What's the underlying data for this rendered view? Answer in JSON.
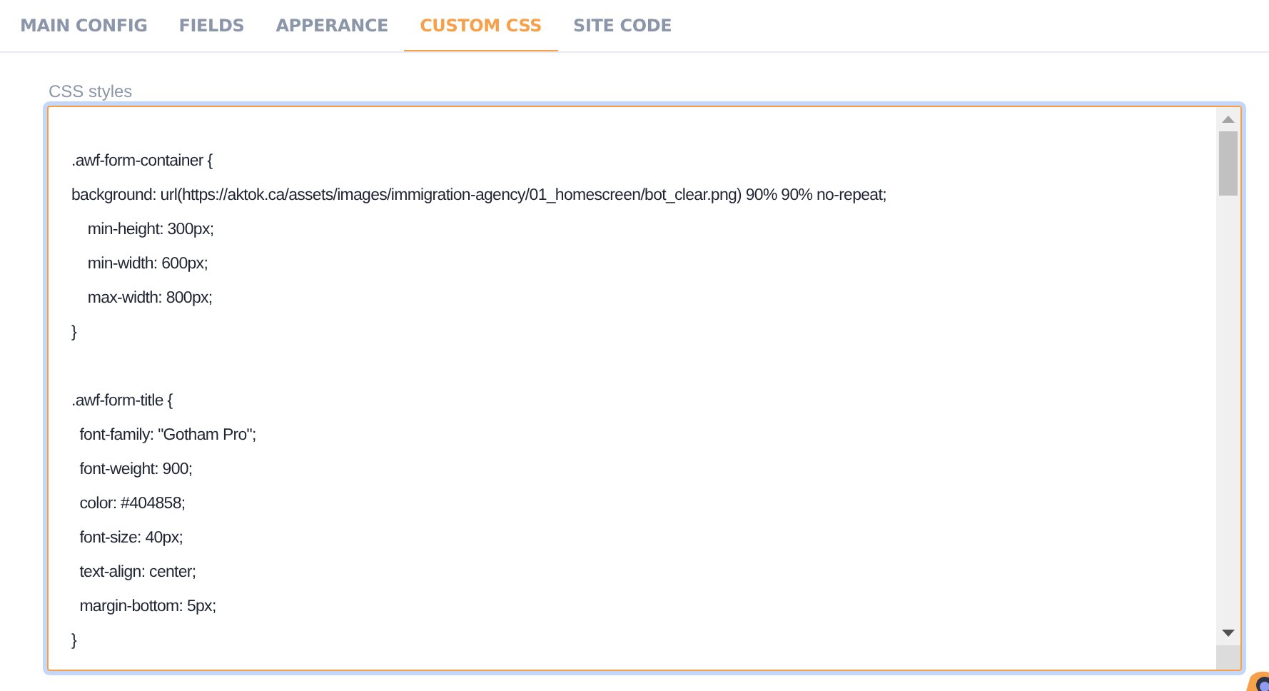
{
  "tabs": [
    {
      "label": "MAIN CONFIG",
      "selected": false
    },
    {
      "label": "FIELDS",
      "selected": false
    },
    {
      "label": "APPERANCE",
      "selected": false
    },
    {
      "label": "CUSTOM CSS",
      "selected": true
    },
    {
      "label": "SITE CODE",
      "selected": false
    }
  ],
  "editor": {
    "label": "CSS styles",
    "focused": true,
    "blocks": [
      {
        "lines": [
          ".awf-form-container {",
          "background: url(https://aktok.ca/assets/images/immigration-agency/01_homescreen/bot_clear.png) 90% 90% no-repeat;",
          "    min-height: 300px;",
          "    min-width: 600px;",
          "    max-width: 800px;",
          "}"
        ]
      },
      {
        "lines": [
          ".awf-form-title {",
          "  font-family: \"Gotham Pro\";",
          "  font-weight: 900;",
          "  color: #404858;",
          "  font-size: 40px;",
          "  text-align: center;",
          "  margin-bottom: 5px;",
          "}"
        ]
      }
    ]
  }
}
